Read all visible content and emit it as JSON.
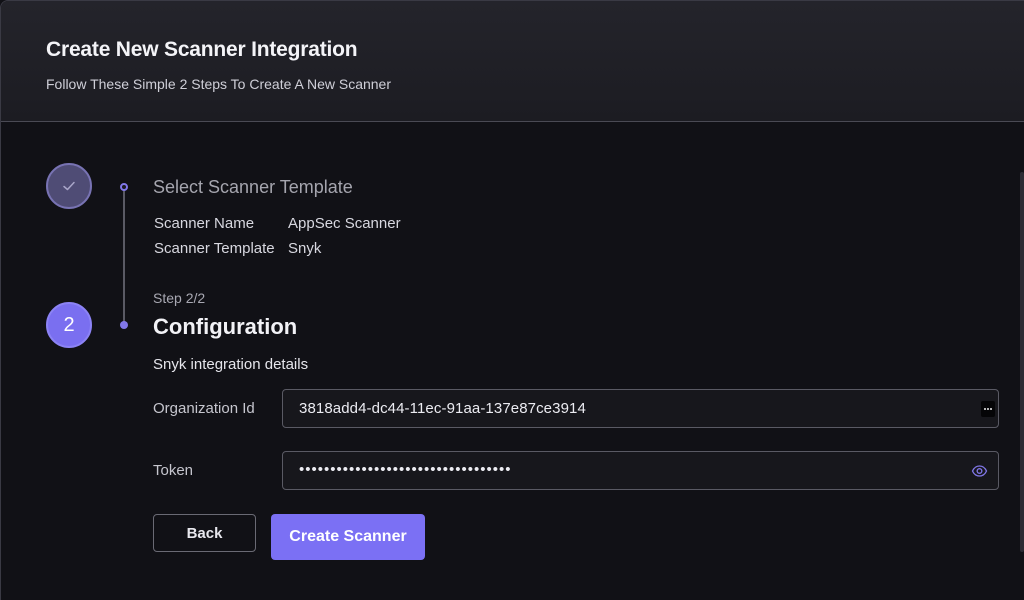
{
  "header": {
    "title": "Create New Scanner Integration",
    "subtitle": "Follow These Simple 2 Steps To Create A New Scanner"
  },
  "stepper": {
    "step1": {
      "icon": "check-icon",
      "title": "Select Scanner Template",
      "summary": [
        {
          "key": "Scanner Name",
          "value": "AppSec Scanner"
        },
        {
          "key": "Scanner Template",
          "value": "Snyk"
        }
      ]
    },
    "step2": {
      "number": "2",
      "counter": "Step 2/2",
      "title": "Configuration",
      "section_label": "Snyk integration details"
    }
  },
  "form": {
    "organization_id": {
      "label": "Organization Id",
      "value": "3818add4-dc44-11ec-91aa-137e87ce3914",
      "icon": "more-dots-icon"
    },
    "token": {
      "label": "Token",
      "value": "••••••••••••••••••••••••••••••••••",
      "icon": "eye-icon"
    }
  },
  "actions": {
    "back_label": "Back",
    "create_label": "Create Scanner"
  },
  "colors": {
    "accent": "#7b70f4",
    "background": "#111116",
    "header_bg": "#1f1f26"
  }
}
